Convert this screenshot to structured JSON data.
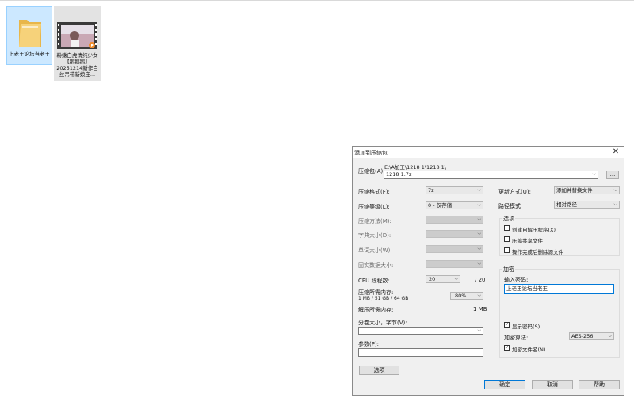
{
  "desktop": {
    "folder_label": "上老王论坛当老王",
    "video_label": "粉嫩白虎清纯少女【鹅鹅鹅】20251214新作白丝吊带新娘庄..."
  },
  "dialog": {
    "title": "添加到压缩包",
    "archive_label": "压缩包(A):",
    "archive_path": "E:\\A加工\\1218 1\\1218 1\\",
    "archive_name": "1218 1.7z",
    "browse_label": "...",
    "format_label": "压缩格式(F):",
    "format_value": "7z",
    "level_label": "压缩等级(L):",
    "level_value": "0 - 仅存储",
    "method_label": "压缩方法(M):",
    "dict_label": "字典大小(D):",
    "word_label": "单词大小(W):",
    "solid_label": "固实数据大小:",
    "threads_label": "CPU 线程数:",
    "threads_value": "20",
    "threads_total": "/ 20",
    "mem_comp_label": "压缩所需内存:",
    "mem_comp_detail": "1 MB / 51 GB / 64 GB",
    "mem_pct": "80%",
    "mem_decomp_label": "解压所需内存:",
    "mem_decomp_value": "1 MB",
    "split_label": "分卷大小，字节(V):",
    "params_label": "参数(P):",
    "options_button": "选项",
    "update_label": "更新方式(U):",
    "update_value": "添加并替换文件",
    "path_label": "路径模式",
    "path_value": "相对路径",
    "opts_group": "选项",
    "opt_sfx": "创建自解压程序(X)",
    "opt_shared": "压缩共享文件",
    "opt_delete": "操作完成后删除源文件",
    "enc_group": "加密",
    "pw_label": "输入密码:",
    "pw_value": "上老王论坛当老王",
    "show_pw": "显示密码(S)",
    "enc_method_label": "加密算法:",
    "enc_method_value": "AES-256",
    "enc_names": "加密文件名(N)",
    "ok": "确定",
    "cancel": "取消",
    "help": "帮助"
  }
}
